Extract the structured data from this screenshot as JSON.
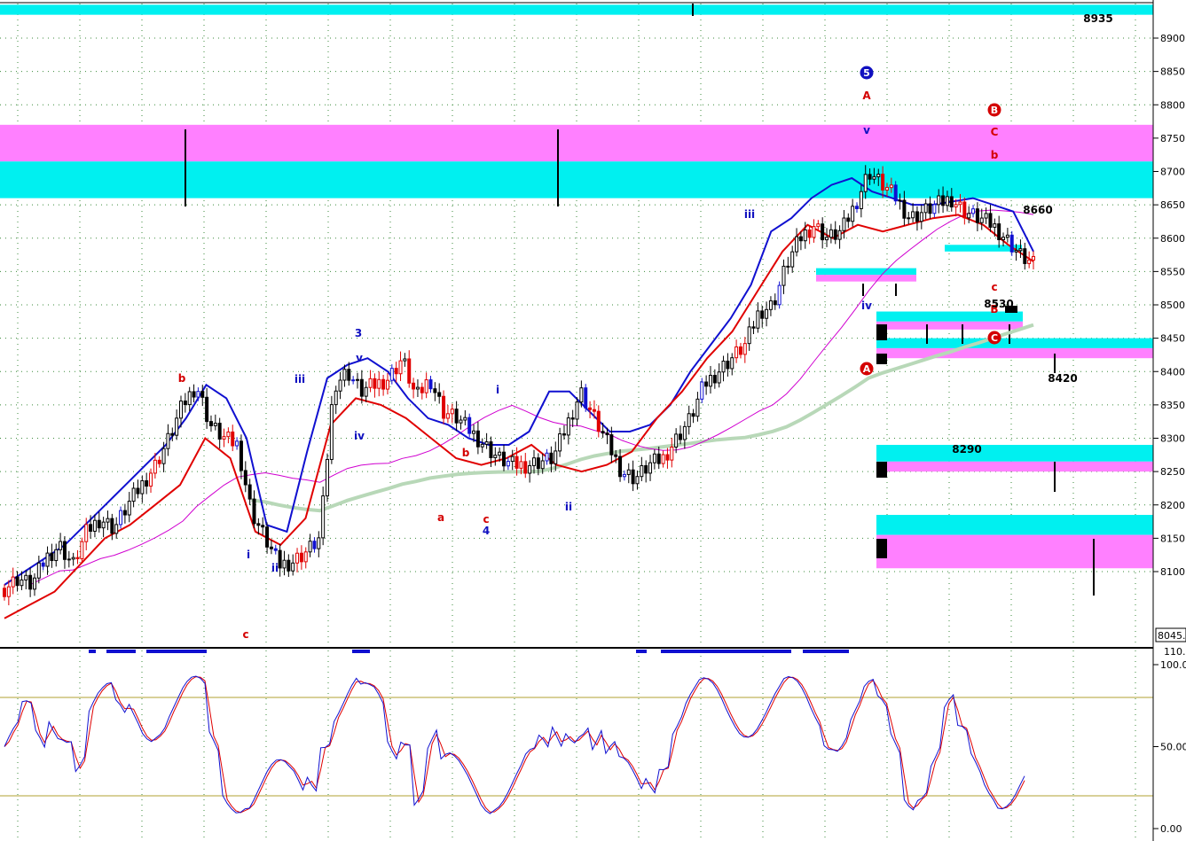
{
  "chart_data": {
    "type": "candlestick",
    "title": "",
    "price_axis": {
      "ticks": [
        "8900",
        "8850",
        "8800",
        "8750",
        "8700",
        "8650",
        "8600",
        "8550",
        "8500",
        "8450",
        "8400",
        "8350",
        "8300",
        "8250",
        "8200",
        "8150",
        "8100"
      ],
      "range": [
        8030,
        8950
      ],
      "last_price": "8045."
    },
    "oscillator_axis": {
      "ticks": [
        "100.0",
        "50.00",
        "0.00"
      ],
      "top_tick": "110.",
      "range": [
        -2,
        112
      ],
      "bands": [
        80,
        20
      ]
    },
    "price_labels": {
      "top": "8935",
      "r1": "8660",
      "s1": "8530",
      "s2": "8420",
      "s3": "8290"
    },
    "zones": [
      {
        "type": "supply-magenta",
        "from": 8715,
        "to": 8770
      },
      {
        "type": "supply-cyan",
        "from": 8660,
        "to": 8715
      },
      {
        "type": "top-cyan",
        "from": 8935,
        "to": 8950
      },
      {
        "type": "target-cyan",
        "from": 8580,
        "to": 8590
      },
      {
        "type": "target-cyan",
        "from": 8545,
        "to": 8555
      },
      {
        "type": "target-magenta",
        "from": 8535,
        "to": 8545
      },
      {
        "type": "target-cyan",
        "from": 8475,
        "to": 8490
      },
      {
        "type": "target-magenta",
        "from": 8463,
        "to": 8475
      },
      {
        "type": "target-cyan",
        "from": 8435,
        "to": 8450
      },
      {
        "type": "target-magenta",
        "from": 8420,
        "to": 8435
      },
      {
        "type": "target-cyan",
        "from": 8265,
        "to": 8290
      },
      {
        "type": "target-magenta",
        "from": 8250,
        "to": 8265
      },
      {
        "type": "target-cyan",
        "from": 8155,
        "to": 8185
      },
      {
        "type": "target-magenta",
        "from": 8105,
        "to": 8155
      }
    ],
    "wave_labels": [
      {
        "text": "b",
        "color": "#d40000"
      },
      {
        "text": "c",
        "color": "#d40000"
      },
      {
        "text": "i",
        "color": "#1010c0"
      },
      {
        "text": "ii",
        "color": "#1010c0"
      },
      {
        "text": "iii",
        "color": "#1010c0"
      },
      {
        "text": "3",
        "color": "#1010c0"
      },
      {
        "text": "v",
        "color": "#1010c0"
      },
      {
        "text": "iv",
        "color": "#1010c0"
      },
      {
        "text": "b",
        "color": "#d40000"
      },
      {
        "text": "a",
        "color": "#d40000"
      },
      {
        "text": "c",
        "color": "#d40000"
      },
      {
        "text": "4",
        "color": "#1010c0"
      },
      {
        "text": "i",
        "color": "#1010c0"
      },
      {
        "text": "ii",
        "color": "#1010c0"
      },
      {
        "text": "iii",
        "color": "#1010c0"
      },
      {
        "text": "A",
        "color": "#d40000"
      },
      {
        "text": "v",
        "color": "#1010c0"
      },
      {
        "text": "iv",
        "color": "#1010c0"
      },
      {
        "text": "C",
        "color": "#d40000"
      },
      {
        "text": "b",
        "color": "#d40000"
      },
      {
        "text": "c",
        "color": "#d40000"
      },
      {
        "text": "B",
        "color": "#d40000"
      }
    ],
    "circle_labels": [
      {
        "text": "5",
        "color": "#1010c0"
      },
      {
        "text": "B",
        "color": "#d40000"
      },
      {
        "text": "C",
        "color": "#d40000"
      },
      {
        "text": "A",
        "color": "#d40000"
      }
    ],
    "series": {
      "close": [
        8075,
        8090,
        8080,
        8120,
        8140,
        8110,
        8160,
        8180,
        8165,
        8200,
        8230,
        8260,
        8300,
        8350,
        8380,
        8320,
        8300,
        8290,
        8190,
        8150,
        8110,
        8115,
        8130,
        8150,
        8380,
        8400,
        8370,
        8380,
        8390,
        8420,
        8360,
        8390,
        8340,
        8330,
        8310,
        8290,
        8270,
        8260,
        8260,
        8265,
        8270,
        8320,
        8370,
        8330,
        8290,
        8250,
        8240,
        8260,
        8270,
        8300,
        8330,
        8380,
        8400,
        8420,
        8440,
        8490,
        8500,
        8560,
        8600,
        8620,
        8600,
        8610,
        8650,
        8700,
        8680,
        8660,
        8630,
        8640,
        8650,
        8660,
        8640,
        8630,
        8620,
        8600,
        8575,
        8560
      ],
      "upper_band": [
        8080,
        8100,
        8120,
        8140,
        8170,
        8200,
        8230,
        8260,
        8290,
        8330,
        8380,
        8360,
        8300,
        8170,
        8160,
        8280,
        8390,
        8410,
        8420,
        8400,
        8360,
        8330,
        8320,
        8300,
        8290,
        8290,
        8310,
        8370,
        8370,
        8340,
        8310,
        8310,
        8320,
        8350,
        8400,
        8440,
        8480,
        8530,
        8610,
        8630,
        8660,
        8680,
        8690,
        8670,
        8660,
        8650,
        8650,
        8655,
        8660,
        8650,
        8640,
        8580
      ],
      "lower_band": [
        8030,
        8050,
        8070,
        8110,
        8150,
        8170,
        8200,
        8230,
        8300,
        8270,
        8160,
        8140,
        8180,
        8320,
        8360,
        8350,
        8330,
        8300,
        8270,
        8260,
        8270,
        8290,
        8260,
        8250,
        8260,
        8280,
        8330,
        8370,
        8420,
        8460,
        8520,
        8580,
        8620,
        8600,
        8620,
        8610,
        8620,
        8630,
        8635,
        8620,
        8590,
        8565
      ]
    }
  }
}
